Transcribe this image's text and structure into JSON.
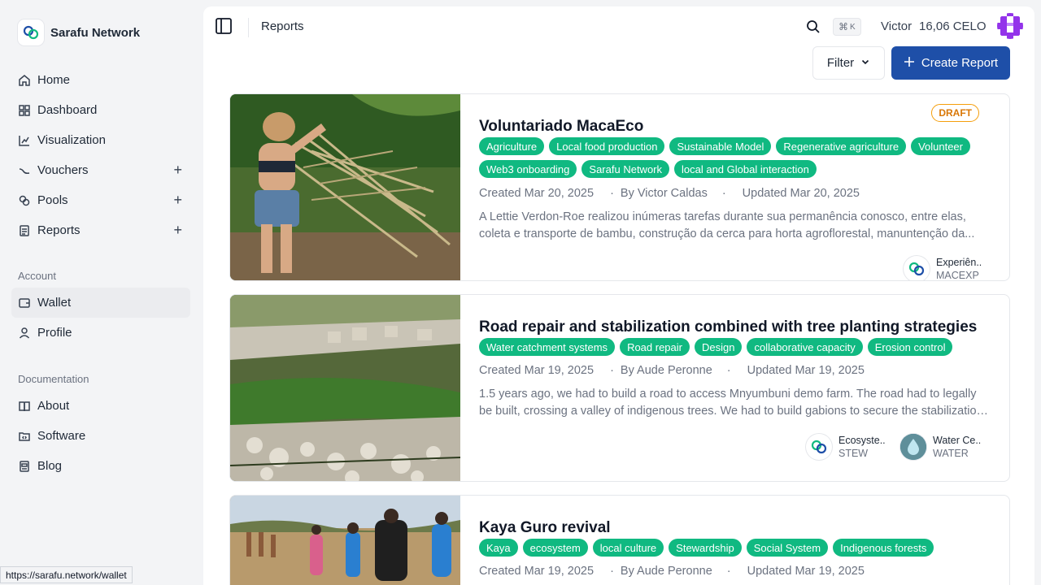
{
  "brand": {
    "name": "Sarafu Network"
  },
  "nav": {
    "main": [
      {
        "label": "Home",
        "icon": "home-icon"
      },
      {
        "label": "Dashboard",
        "icon": "dashboard-icon"
      },
      {
        "label": "Visualization",
        "icon": "chart-icon"
      },
      {
        "label": "Vouchers",
        "icon": "voucher-icon",
        "plus": "+"
      },
      {
        "label": "Pools",
        "icon": "pools-icon",
        "plus": "+"
      },
      {
        "label": "Reports",
        "icon": "reports-icon",
        "plus": "+"
      }
    ],
    "account_label": "Account",
    "account": [
      {
        "label": "Wallet",
        "icon": "wallet-icon"
      },
      {
        "label": "Profile",
        "icon": "user-icon"
      }
    ],
    "docs_label": "Documentation",
    "docs": [
      {
        "label": "About",
        "icon": "book-icon"
      },
      {
        "label": "Software",
        "icon": "folder-code-icon"
      },
      {
        "label": "Blog",
        "icon": "newspaper-icon"
      }
    ]
  },
  "topbar": {
    "breadcrumb": "Reports",
    "shortcut_cmd": "⌘",
    "shortcut_key": "K",
    "user_name": "Victor",
    "balance": "16,06 CELO"
  },
  "toolbar": {
    "filter_label": "Filter",
    "create_label": "Create Report"
  },
  "reports": [
    {
      "title": "Voluntariado MacaEco",
      "status": "DRAFT",
      "tags": [
        "Agriculture",
        "Local food production",
        "Sustainable Model",
        "Regenerative agriculture",
        "Volunteer",
        "Web3 onboarding",
        "Sarafu Network",
        "local and Global interaction"
      ],
      "created": "Created Mar 20, 2025",
      "author": "By Victor Caldas",
      "updated": "Updated Mar 20, 2025",
      "description": "A Lettie Verdon-Roe realizou inúmeras tarefas durante sua permanência conosco, entre elas, coleta e transporte de bambu, construção da cerca para horta agroflorestal, manuntenção da...",
      "vouchers": [
        {
          "name": "Experiên..",
          "symbol": "MACEXP"
        }
      ]
    },
    {
      "title": "Road repair and stabilization combined with tree planting strategies",
      "tags": [
        "Water catchment systems",
        "Road repair",
        "Design",
        "collaborative capacity",
        "Erosion control"
      ],
      "created": "Created Mar 19, 2025",
      "author": "By Aude Peronne",
      "updated": "Updated Mar 19, 2025",
      "description": "1.5 years ago, we had to build a road to access Mnyumbuni demo farm. The road had to legally be built, crossing a valley of indigenous trees. We had to build gabions to secure the stabilization of...",
      "vouchers": [
        {
          "name": "Ecosyste..",
          "symbol": "STEW"
        },
        {
          "name": "Water Ce..",
          "symbol": "WATER"
        }
      ]
    },
    {
      "title": "Kaya Guro revival",
      "tags": [
        "Kaya",
        "ecosystem",
        "local culture",
        "Stewardship",
        "Social System",
        "Indigenous forests"
      ],
      "created": "Created Mar 19, 2025",
      "author": "By Aude Peronne",
      "updated": "Updated Mar 19, 2025"
    }
  ],
  "status_url": "https://sarafu.network/wallet"
}
